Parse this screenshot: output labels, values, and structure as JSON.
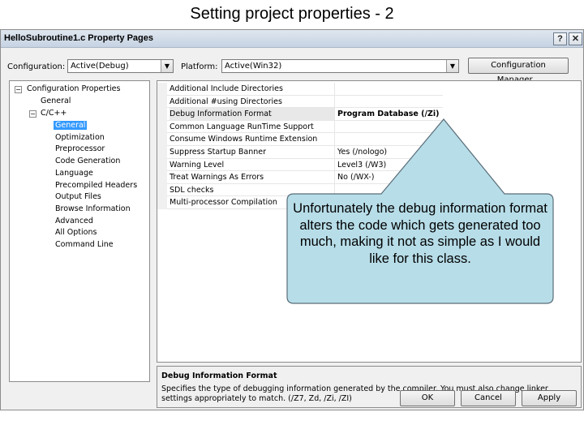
{
  "slide": {
    "title": "Setting project properties - 2"
  },
  "window": {
    "title": "HelloSubroutine1.c Property Pages",
    "help_label": "?",
    "close_label": "✕"
  },
  "toolbar": {
    "configuration_label": "Configuration:",
    "configuration_value": "Active(Debug)",
    "platform_label": "Platform:",
    "platform_value": "Active(Win32)",
    "config_manager_label": "Configuration Manager..."
  },
  "tree": {
    "root": "Configuration Properties",
    "general": "General",
    "cpp": "C/C++",
    "children": [
      "General",
      "Optimization",
      "Preprocessor",
      "Code Generation",
      "Language",
      "Precompiled Headers",
      "Output Files",
      "Browse Information",
      "Advanced",
      "All Options",
      "Command Line"
    ],
    "selected_index": 0
  },
  "grid": {
    "rows": [
      {
        "name": "Additional Include Directories",
        "value": ""
      },
      {
        "name": "Additional #using Directories",
        "value": ""
      },
      {
        "name": "Debug Information Format",
        "value": "Program Database (/Zi)"
      },
      {
        "name": "Common Language RunTime Support",
        "value": ""
      },
      {
        "name": "Consume Windows Runtime Extension",
        "value": ""
      },
      {
        "name": "Suppress Startup Banner",
        "value": "Yes (/nologo)"
      },
      {
        "name": "Warning Level",
        "value": "Level3 (/W3)"
      },
      {
        "name": "Treat Warnings As Errors",
        "value": "No (/WX-)"
      },
      {
        "name": "SDL checks",
        "value": ""
      },
      {
        "name": "Multi-processor Compilation",
        "value": ""
      }
    ],
    "selected_index": 2
  },
  "description": {
    "title": "Debug Information Format",
    "text": "Specifies the type of debugging information generated by the compiler.  You must also change linker settings appropriately to match.    (/Z7, Zd, /Zi, /ZI)"
  },
  "buttons": {
    "ok": "OK",
    "cancel": "Cancel",
    "apply": "Apply"
  },
  "callout": {
    "text": "Unfortunately the debug information format alters the code which gets generated too much, making it not as simple as I would like for this class.",
    "fill": "#b7dde8",
    "stroke": "#5a6e7a"
  },
  "icons": {
    "expanded": "minus-box-icon",
    "dropdown": "chevron-down-icon",
    "help": "help-icon",
    "close": "close-icon"
  }
}
